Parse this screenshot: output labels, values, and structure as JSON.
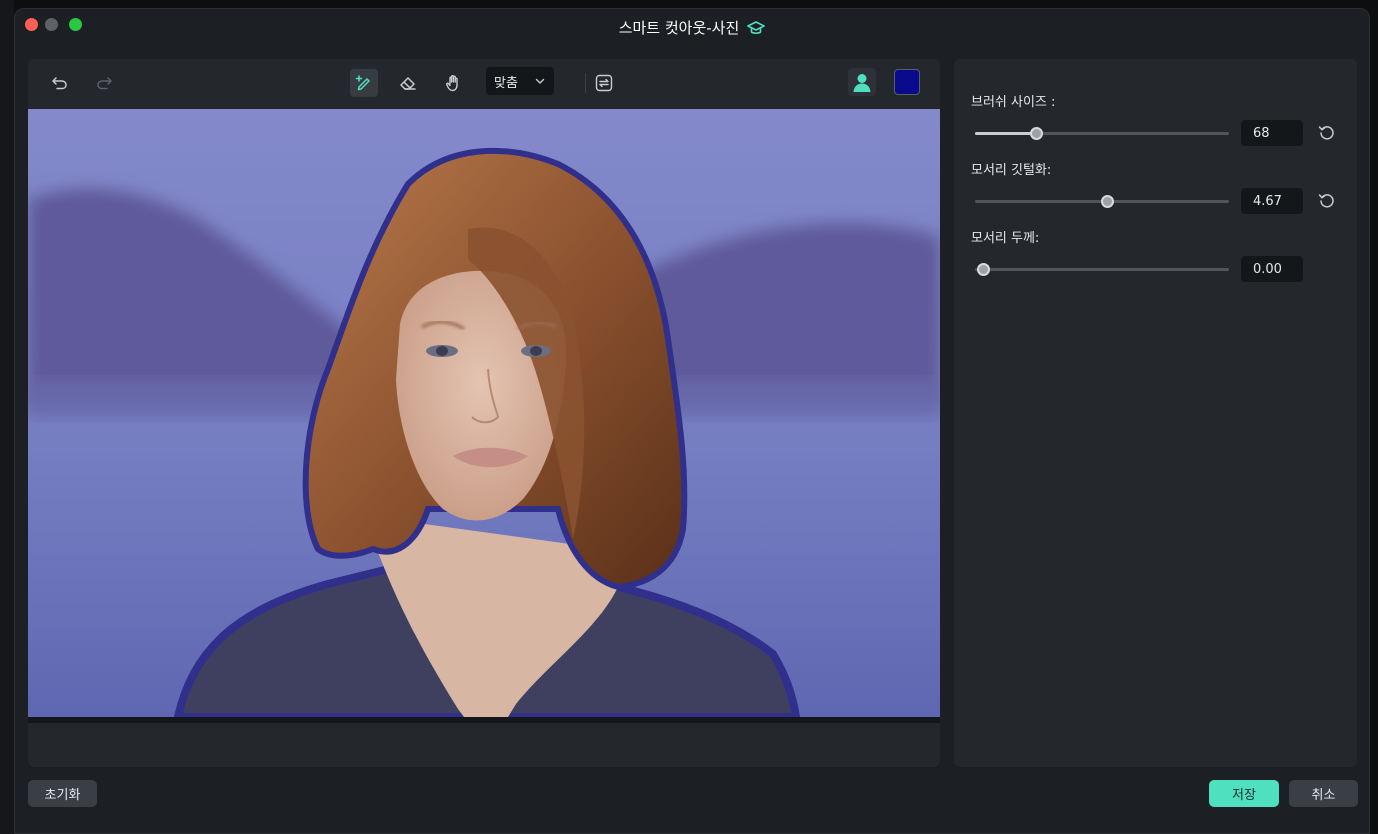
{
  "window": {
    "title": "스마트 컷아웃-사진",
    "title_icon": "graduation-cap-icon",
    "accent_color": "#4fe0c0"
  },
  "toolbar": {
    "undo_icon": "undo-icon",
    "redo_icon": "redo-icon",
    "brush_icon": "smart-brush-icon",
    "eraser_icon": "eraser-icon",
    "hand_icon": "hand-icon",
    "zoom_value": "맞춤",
    "swap_icon": "swap-icon",
    "foreground_icon": "person-icon",
    "mask_color": "#0a0a8c"
  },
  "settings": {
    "brush_size": {
      "label": "브러쉬 사이즈 :",
      "value": "68",
      "level": 0.24
    },
    "edge_feather": {
      "label": "모서리 깃털화:",
      "value": "4.67",
      "level": 0.52
    },
    "edge_thickness": {
      "label": "모서리 두께:",
      "value": "0.00",
      "level": 0.03
    }
  },
  "buttons": {
    "reset": "초기화",
    "save": "저장",
    "cancel": "취소"
  }
}
